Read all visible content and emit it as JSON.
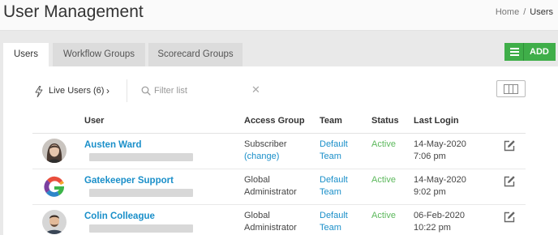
{
  "header": {
    "title": "User Management",
    "breadcrumb": {
      "home": "Home",
      "separator": "/",
      "current": "Users"
    }
  },
  "tabs": [
    {
      "label": "Users",
      "active": true
    },
    {
      "label": "Workflow Groups",
      "active": false
    },
    {
      "label": "Scorecard Groups",
      "active": false
    }
  ],
  "toolbar": {
    "add_label": "ADD",
    "add_icon": "menu-icon",
    "accent": "#3fae49"
  },
  "filter": {
    "live_users_label": "Live Users (6)",
    "live_users_chevron": "›",
    "placeholder": "Filter list",
    "clear_symbol": "✕"
  },
  "table": {
    "columns": {
      "user": "User",
      "access": "Access Group",
      "team": "Team",
      "status": "Status",
      "login": "Last Login"
    },
    "rows": [
      {
        "name": "Austen Ward",
        "access_line1": "Subscriber",
        "access_link": "(change)",
        "access_line2": "",
        "team_line1": "Default",
        "team_line2": "Team",
        "status": "Active",
        "login_date": "14-May-2020",
        "login_time": "7:06 pm",
        "avatar": "photo-woman"
      },
      {
        "name": "Gatekeeper Support",
        "access_line1": "Global",
        "access_link": "",
        "access_line2": "Administrator",
        "team_line1": "Default",
        "team_line2": "Team",
        "status": "Active",
        "login_date": "14-May-2020",
        "login_time": "9:02 pm",
        "avatar": "gatekeeper-logo"
      },
      {
        "name": "Colin Colleague",
        "access_line1": "Global",
        "access_link": "",
        "access_line2": "Administrator",
        "team_line1": "Default",
        "team_line2": "Team",
        "status": "Active",
        "login_date": "06-Feb-2020",
        "login_time": "10:22 pm",
        "avatar": "photo-man"
      }
    ]
  },
  "colors": {
    "link": "#1a8fc9",
    "status_active": "#5cb85c"
  }
}
